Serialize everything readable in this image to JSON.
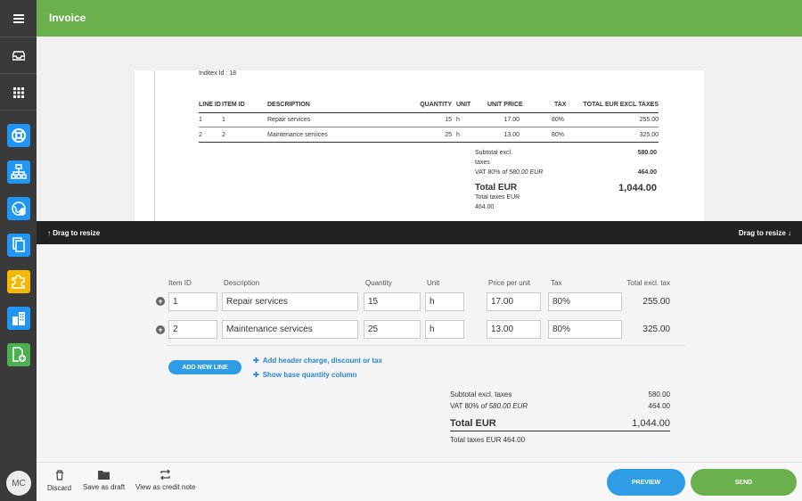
{
  "app": {
    "title": "Invoice",
    "user_initials": "MC"
  },
  "rail": {
    "items": [
      {
        "icon": "menu-icon"
      },
      {
        "icon": "inbox-icon"
      },
      {
        "icon": "apps-grid-icon"
      },
      {
        "icon": "lifebuoy-icon",
        "color": "#2196f3"
      },
      {
        "icon": "sitemap-icon",
        "color": "#2196f3"
      },
      {
        "icon": "globe-icon",
        "color": "#2196f3"
      },
      {
        "icon": "documents-icon",
        "color": "#2196f3"
      },
      {
        "icon": "puzzle-icon",
        "color": "#f5b800"
      },
      {
        "icon": "buildings-icon",
        "color": "#2196f3"
      },
      {
        "icon": "document-add-icon",
        "color": "#4caf50"
      }
    ]
  },
  "document": {
    "inditex_id": "Inditex Id : 18",
    "headers": [
      "LINE ID",
      "ITEM ID",
      "DESCRIPTION",
      "QUANTITY",
      "UNIT",
      "UNIT PRICE",
      "TAX",
      "TOTAL EUR EXCL TAXES"
    ],
    "lines": [
      {
        "line_id": "1",
        "item_id": "1",
        "description": "Repair services",
        "quantity": "15",
        "unit": "h",
        "unit_price": "17.00",
        "tax": "80%",
        "total": "255.00"
      },
      {
        "line_id": "2",
        "item_id": "2",
        "description": "Maintenance services",
        "quantity": "25",
        "unit": "h",
        "unit_price": "13.00",
        "tax": "80%",
        "total": "325.00"
      }
    ],
    "subtotal_label_1": "Subtotal excl.",
    "subtotal_label_2": "taxes",
    "subtotal_value": "580.00",
    "vat_label": "VAT 80%",
    "vat_of": "of 580.00 EUR",
    "vat_value": "464.00",
    "total_label": "Total EUR",
    "total_value": "1,044.00",
    "total_taxes_label": "Total taxes EUR",
    "total_taxes_value": "464.00"
  },
  "dragbar": {
    "left": "Drag to resize",
    "right": "Drag to resize"
  },
  "editor": {
    "columns": {
      "item_id": "Item ID",
      "description": "Description",
      "quantity": "Quantity",
      "unit": "Unit",
      "price": "Price per unit",
      "tax": "Tax",
      "total": "Total excl. tax"
    },
    "rows": [
      {
        "item_id": "1",
        "description": "Repair services",
        "quantity": "15",
        "unit": "h",
        "price": "17.00",
        "tax": "80%",
        "total": "255.00"
      },
      {
        "item_id": "2",
        "description": "Maintenance services",
        "quantity": "25",
        "unit": "h",
        "price": "13.00",
        "tax": "80%",
        "total": "325.00"
      }
    ],
    "add_line": "ADD NEW LINE",
    "add_header_charge": "Add header charge, discount or tax",
    "show_base_quantity": "Show base quantity column",
    "totals": {
      "subtotal_label": "Subtotal excl. taxes",
      "subtotal_value": "580.00",
      "vat_label": "VAT 80%",
      "vat_of": "of 580.00 EUR",
      "vat_value": "464.00",
      "total_label": "Total EUR",
      "total_value": "1,044.00",
      "total_taxes": "Total taxes EUR 464.00"
    }
  },
  "footer": {
    "discard": "Discard",
    "save_draft": "Save as draft",
    "view_credit_note": "View as credit note",
    "preview": "PREVIEW",
    "send": "SEND"
  },
  "colors": {
    "brand_green": "#6ab04c",
    "accent_blue": "#2f9de6",
    "rail_bg": "#3a3a3a"
  }
}
